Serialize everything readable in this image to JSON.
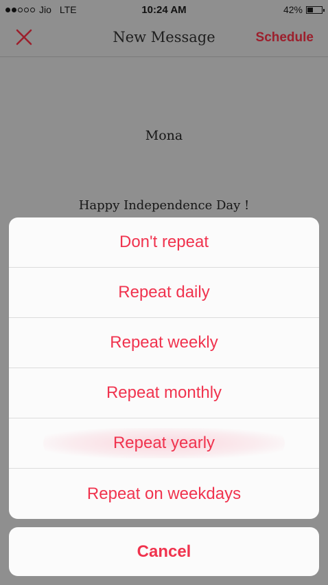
{
  "status_bar": {
    "signal_dots_filled": 2,
    "signal_dots_total": 5,
    "carrier": "Jio",
    "network": "LTE",
    "time": "10:24 AM",
    "battery_percent_label": "42%",
    "battery_level": 0.42
  },
  "nav": {
    "close_icon": "close-icon",
    "title": "New Message",
    "schedule_label": "Schedule",
    "accent_color": "#9c1f2c"
  },
  "message": {
    "recipient": "Mona",
    "text": "Happy Independence Day !"
  },
  "action_sheet": {
    "options": [
      {
        "label": "Don't repeat"
      },
      {
        "label": "Repeat daily"
      },
      {
        "label": "Repeat weekly"
      },
      {
        "label": "Repeat monthly"
      },
      {
        "label": "Repeat yearly"
      },
      {
        "label": "Repeat on weekdays"
      }
    ],
    "cancel_label": "Cancel",
    "option_color": "#f0334e"
  }
}
